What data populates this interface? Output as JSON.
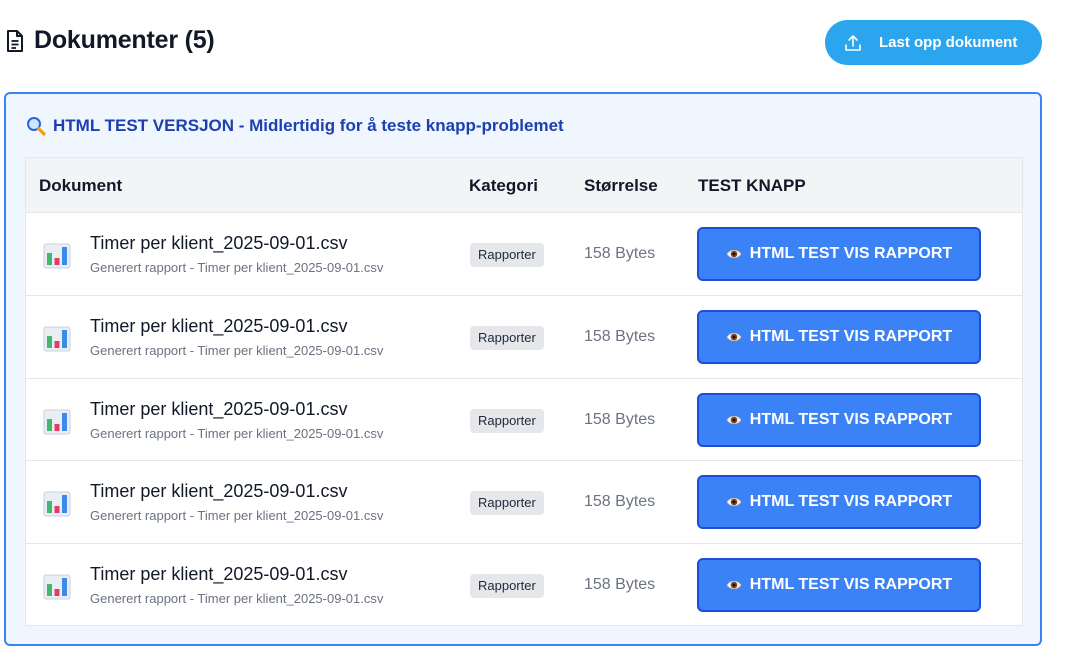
{
  "header": {
    "title": "Dokumenter (5)",
    "upload_label": "Last opp dokument"
  },
  "panel": {
    "heading": "HTML TEST VERSJON - Midlertidig for å teste knapp-problemet"
  },
  "table": {
    "columns": [
      "Dokument",
      "Kategori",
      "Størrelse",
      "TEST KNAPP"
    ],
    "rows": [
      {
        "name": "Timer per klient_2025-09-01.csv",
        "description": "Generert rapport - Timer per klient_2025-09-01.csv",
        "category": "Rapporter",
        "size": "158 Bytes",
        "button": "HTML TEST VIS RAPPORT"
      },
      {
        "name": "Timer per klient_2025-09-01.csv",
        "description": "Generert rapport - Timer per klient_2025-09-01.csv",
        "category": "Rapporter",
        "size": "158 Bytes",
        "button": "HTML TEST VIS RAPPORT"
      },
      {
        "name": "Timer per klient_2025-09-01.csv",
        "description": "Generert rapport - Timer per klient_2025-09-01.csv",
        "category": "Rapporter",
        "size": "158 Bytes",
        "button": "HTML TEST VIS RAPPORT"
      },
      {
        "name": "Timer per klient_2025-09-01.csv",
        "description": "Generert rapport - Timer per klient_2025-09-01.csv",
        "category": "Rapporter",
        "size": "158 Bytes",
        "button": "HTML TEST VIS RAPPORT"
      },
      {
        "name": "Timer per klient_2025-09-01.csv",
        "description": "Generert rapport - Timer per klient_2025-09-01.csv",
        "category": "Rapporter",
        "size": "158 Bytes",
        "button": "HTML TEST VIS RAPPORT"
      }
    ]
  },
  "icons": {
    "title": "document-icon",
    "upload": "upload-icon",
    "heading": "magnifier-icon",
    "file": "bar-chart-icon",
    "button": "eye-icon"
  },
  "colors": {
    "upload_button": "#2ba6ee",
    "panel_border": "#3b82f6",
    "panel_background": "#eff6fe",
    "heading_text": "#1e40af",
    "test_button": "#3b82f6",
    "test_button_border": "#1d4ed8"
  }
}
